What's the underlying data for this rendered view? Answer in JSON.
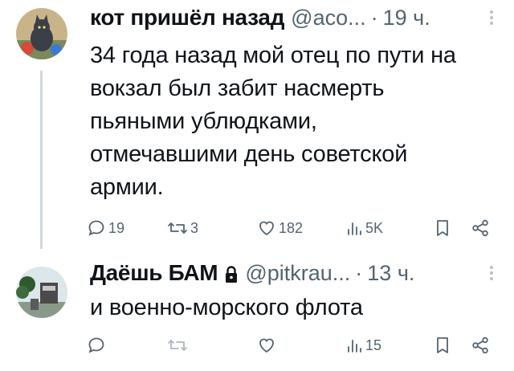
{
  "tweets": [
    {
      "author": "кот пришёл назад",
      "handle": "@aco...",
      "separator": "·",
      "time": "19 ч.",
      "lines": [
        "34 года назад мой отец по пути на",
        "вокзал был забит насмерть",
        "пьяными ублюдками,",
        "отмечавшими день советской",
        "армии."
      ],
      "replies": "19",
      "retweets": "3",
      "likes": "182",
      "views": "5K"
    },
    {
      "author": "Даёшь БАМ",
      "handle": "@pitkrau...",
      "separator": "·",
      "time": "13 ч.",
      "lines": [
        "и военно-морского флота"
      ],
      "replies": "",
      "retweets": "",
      "likes": "",
      "views": "15"
    }
  ],
  "colors": {
    "text": "#0f1419",
    "muted": "#536471",
    "thread_line": "#cfd9de"
  },
  "icons": [
    "reply-icon",
    "retweet-icon",
    "like-icon",
    "views-icon",
    "bookmark-icon",
    "share-icon",
    "lock-icon",
    "more-icon"
  ]
}
